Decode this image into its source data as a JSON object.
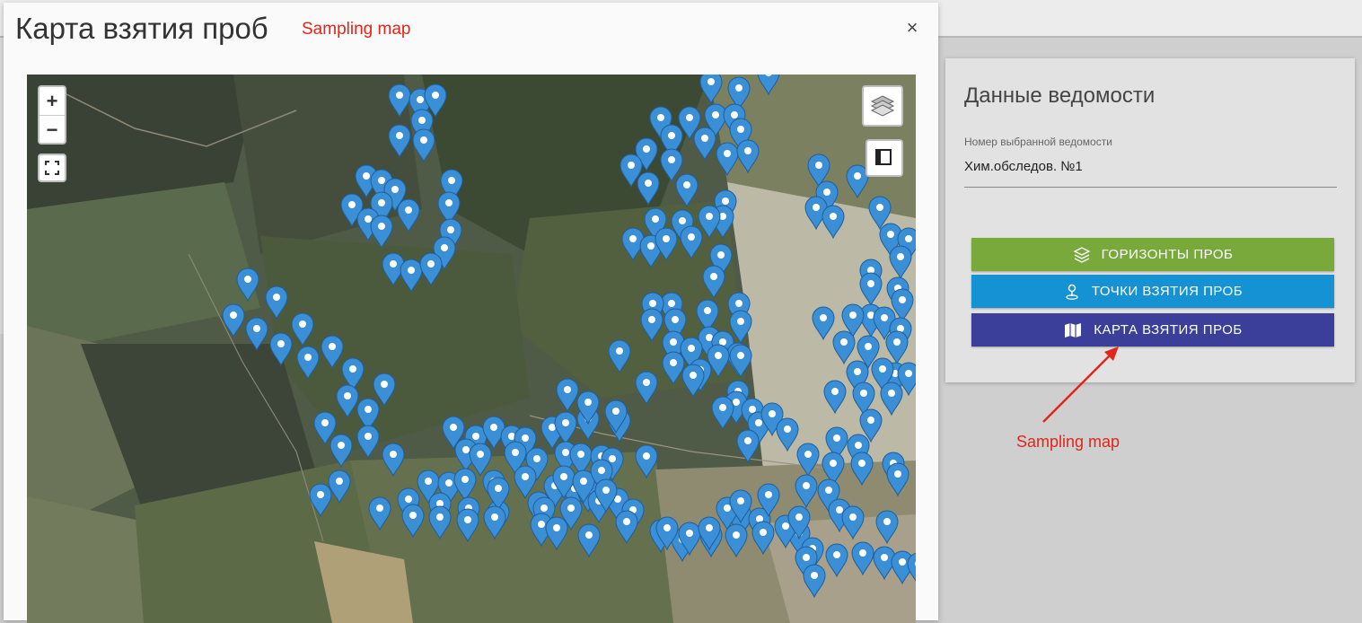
{
  "modal": {
    "title": "Карта взятия проб",
    "annotation": "Sampling map",
    "close": "×"
  },
  "map": {
    "zoom_in": "+",
    "zoom_out": "−",
    "marker_color": "#3a8fd6"
  },
  "panel": {
    "title": "Данные ведомости",
    "field_label": "Номер выбранной ведомости",
    "field_value": "Хим.обследов. №1",
    "buttons": {
      "horizons": "ГОРИЗОНТЫ ПРОБ",
      "points": "ТОЧКИ ВЗЯТИЯ ПРОБ",
      "map": "КАРТА ВЗЯТИЯ ПРОБ"
    }
  },
  "annotation": {
    "text": "Sampling map",
    "color": "#e0261a"
  },
  "colors": {
    "green": "#7aa93b",
    "blue": "#1592d3",
    "indigo": "#3c3f9a"
  }
}
